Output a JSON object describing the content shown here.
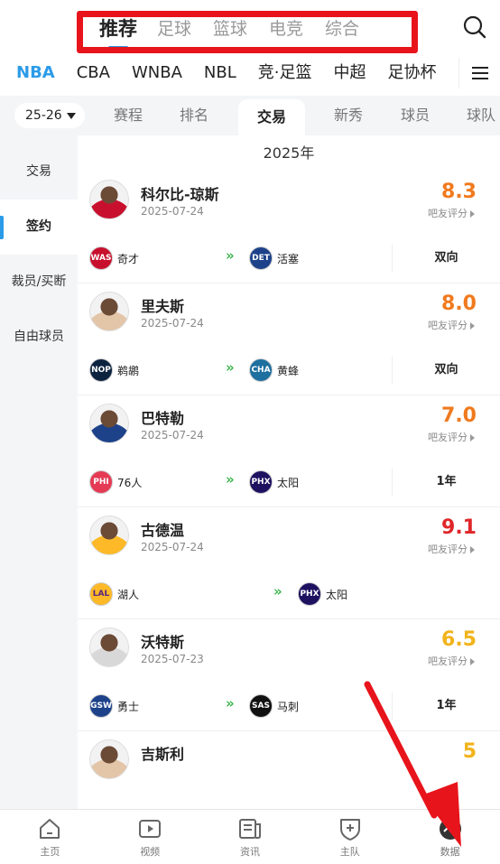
{
  "top_tabs": [
    "推荐",
    "足球",
    "篮球",
    "电竞",
    "综合"
  ],
  "league_tabs": [
    "NBA",
    "CBA",
    "WNBA",
    "NBL",
    "竞·足篮",
    "中超",
    "足协杯"
  ],
  "season": "25-26",
  "sub_tabs": [
    "赛程",
    "排名",
    "交易",
    "新秀",
    "球员",
    "球队"
  ],
  "side_nav": [
    "交易",
    "签约",
    "裁员/买断",
    "自由球员"
  ],
  "year": "2025年",
  "score_label": "吧友评分",
  "players": [
    {
      "name": "科尔比-琼斯",
      "date": "2025-07-24",
      "score": "8.3",
      "score_color": "#f07a1e",
      "from": {
        "abbr": "WAS",
        "name": "奇才",
        "color": "#c8102e"
      },
      "to": {
        "abbr": "DET",
        "name": "活塞",
        "color": "#1d428a"
      },
      "contract": "双向"
    },
    {
      "name": "里夫斯",
      "date": "2025-07-24",
      "score": "8.0",
      "score_color": "#f07a1e",
      "from": {
        "abbr": "NOP",
        "name": "鹈鹕",
        "color": "#0c2340"
      },
      "to": {
        "abbr": "CHA",
        "name": "黄蜂",
        "color": "#1d6f9f"
      },
      "contract": "双向"
    },
    {
      "name": "巴特勒",
      "date": "2025-07-24",
      "score": "7.0",
      "score_color": "#f07a1e",
      "from": {
        "abbr": "PHI",
        "name": "76人",
        "color": "#e53a54"
      },
      "to": {
        "abbr": "PHX",
        "name": "太阳",
        "color": "#1d1160"
      },
      "contract": "1年"
    },
    {
      "name": "古德温",
      "date": "2025-07-24",
      "score": "9.1",
      "score_color": "#e0262a",
      "from": {
        "abbr": "LAL",
        "name": "湖人",
        "color": "#fdb927"
      },
      "to": {
        "abbr": "PHX",
        "name": "太阳",
        "color": "#1d1160"
      },
      "contract": ""
    },
    {
      "name": "沃特斯",
      "date": "2025-07-23",
      "score": "6.5",
      "score_color": "#f2b31a",
      "from": {
        "abbr": "GSW",
        "name": "勇士",
        "color": "#1d428a"
      },
      "to": {
        "abbr": "SAS",
        "name": "马刺",
        "color": "#111111"
      },
      "contract": "1年"
    },
    {
      "name": "吉斯利",
      "date": "",
      "score": "5",
      "score_color": "#f2b31a",
      "from": {
        "abbr": "",
        "name": "",
        "color": "#ffffff"
      },
      "to": {
        "abbr": "",
        "name": "",
        "color": "#ffffff"
      },
      "contract": ""
    }
  ],
  "bottom_nav": [
    {
      "label": "主页",
      "icon": "home-icon"
    },
    {
      "label": "视频",
      "icon": "video-icon"
    },
    {
      "label": "资讯",
      "icon": "news-icon"
    },
    {
      "label": "主队",
      "icon": "team-shield-icon"
    },
    {
      "label": "数据",
      "icon": "data-chart-icon"
    }
  ],
  "colors": {
    "accent": "#2b9be8",
    "highlight": "#e8141b",
    "arrow_green": "#3cb64b"
  }
}
